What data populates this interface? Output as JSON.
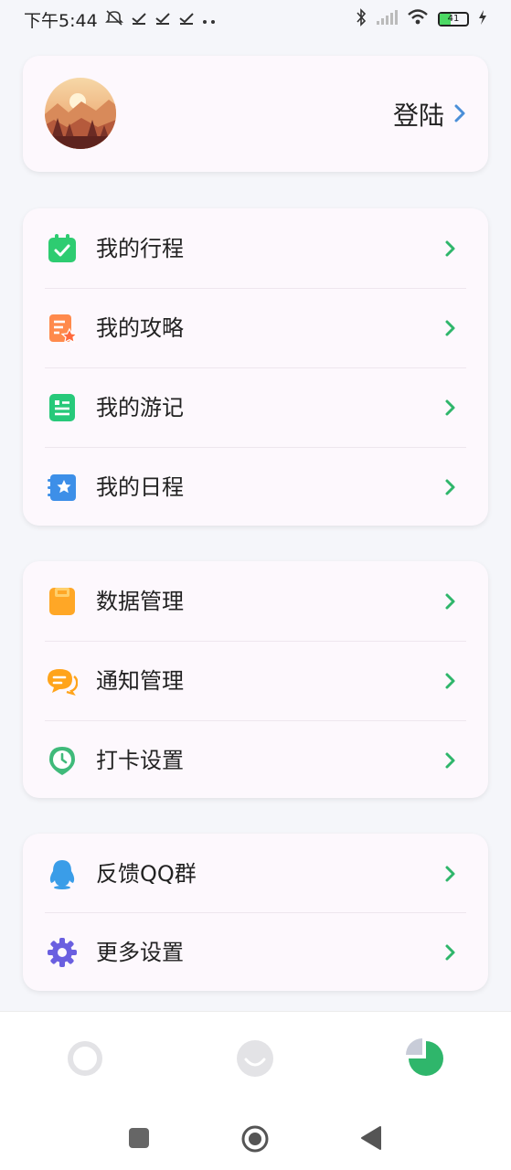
{
  "status_bar": {
    "time": "下午5:44",
    "left_icons": [
      "mute-icon",
      "check-icon",
      "check-icon",
      "check-icon",
      "more-icon"
    ],
    "right_icons": [
      "bluetooth-icon",
      "signal-icon",
      "wifi-icon",
      "battery-icon",
      "charging-icon"
    ],
    "battery_level": "41"
  },
  "profile": {
    "login_label": "登陆"
  },
  "groups": [
    {
      "items": [
        {
          "label": "我的行程",
          "icon": "calendar-check-icon",
          "color": "#2ecc71"
        },
        {
          "label": "我的攻略",
          "icon": "guide-star-icon",
          "color": "#ff7f45"
        },
        {
          "label": "我的游记",
          "icon": "notes-icon",
          "color": "#27c97a"
        },
        {
          "label": "我的日程",
          "icon": "schedule-star-icon",
          "color": "#3d8fe8"
        }
      ]
    },
    {
      "items": [
        {
          "label": "数据管理",
          "icon": "data-icon",
          "color": "#ffa726"
        },
        {
          "label": "通知管理",
          "icon": "notification-icon",
          "color": "#ffa41b"
        },
        {
          "label": "打卡设置",
          "icon": "clock-pin-icon",
          "color": "#3fba7a"
        }
      ]
    },
    {
      "items": [
        {
          "label": "反馈QQ群",
          "icon": "qq-penguin-icon",
          "color": "#3a9de8"
        },
        {
          "label": "更多设置",
          "icon": "gear-icon",
          "color": "#6a5fe0"
        }
      ]
    }
  ],
  "tabbar": {
    "tabs": [
      {
        "icon": "circle-tab-icon",
        "active": false
      },
      {
        "icon": "smile-tab-icon",
        "active": false
      },
      {
        "icon": "pie-chart-tab-icon",
        "active": true
      }
    ]
  },
  "colors": {
    "chevron": "#2fb66b",
    "login_chevron": "#4a8fd8",
    "card_bg": "#fdf8fd",
    "page_bg": "#f5f6fa"
  }
}
